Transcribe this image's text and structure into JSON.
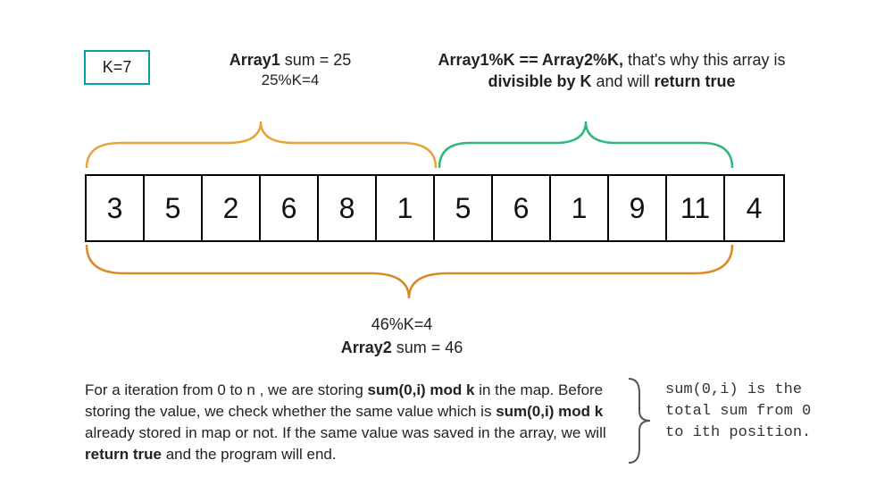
{
  "k_label": "K=7",
  "anno_left_l1_a": "Array1",
  "anno_left_l1_b": " sum = 25",
  "anno_left_l2": "25%K=4",
  "anno_right_a": "Array1%K == Array2%K,",
  "anno_right_b": " that's why this array is ",
  "anno_right_c": "divisible by K",
  "anno_right_d": " and will ",
  "anno_right_e": "return true",
  "cells": [
    "3",
    "5",
    "2",
    "6",
    "8",
    "1",
    "5",
    "6",
    "1",
    "9",
    "11",
    "4"
  ],
  "anno_bottom_l1": "46%K=4",
  "anno_bottom_l2_a": "Array2",
  "anno_bottom_l2_b": " sum = 46",
  "explain_a": "For a iteration from 0 to n , we are storing ",
  "explain_b": "sum(0,i) mod k",
  "explain_c": " in the map. Before storing the value, we check whether the same value which is ",
  "explain_d": "sum(0,i) mod k",
  "explain_e": " already stored in map or not. If the same value was saved in the array, we will ",
  "explain_f": "return true",
  "explain_g": " and the program will end.",
  "sidenote": "sum(0,i) is the total sum from 0 to ith position."
}
